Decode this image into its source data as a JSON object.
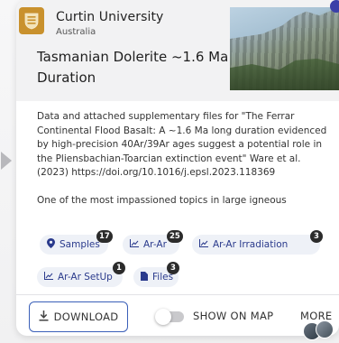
{
  "institution": {
    "name": "Curtin University",
    "country": "Australia",
    "logo_color": "#c9912d"
  },
  "dataset": {
    "title": "Tasmanian Dolerite ~1.6 Ma Duration",
    "description_p1": "Data and attached supplementary files for \"The Ferrar Continental Flood Basalt: A ~1.6 Ma long duration evidenced by high-precision 40Ar/39Ar ages suggest a potential role in the Pliensbachian-Toarcian extinction event\" Ware et al. (2023) https://doi.org/10.1016/j.epsl.2023.118369",
    "description_p2": "One of the most impassioned topics in large igneous"
  },
  "tags": [
    {
      "label": "Samples",
      "icon": "location-pin-icon",
      "count": "17"
    },
    {
      "label": "Ar-Ar",
      "icon": "chart-icon",
      "count": "25"
    },
    {
      "label": "Ar-Ar Irradiation",
      "icon": "chart-icon",
      "count": "3"
    },
    {
      "label": "Ar-Ar SetUp",
      "icon": "chart-icon",
      "count": "1"
    },
    {
      "label": "Files",
      "icon": "file-icon",
      "count": "3"
    }
  ],
  "actions": {
    "download": "DOWNLOAD",
    "show_on_map": "SHOW ON MAP",
    "more": "MORE"
  },
  "colors": {
    "accent": "#2a3a8c",
    "tag_bg": "#eef1f7",
    "download_border": "#3a5fb8"
  }
}
